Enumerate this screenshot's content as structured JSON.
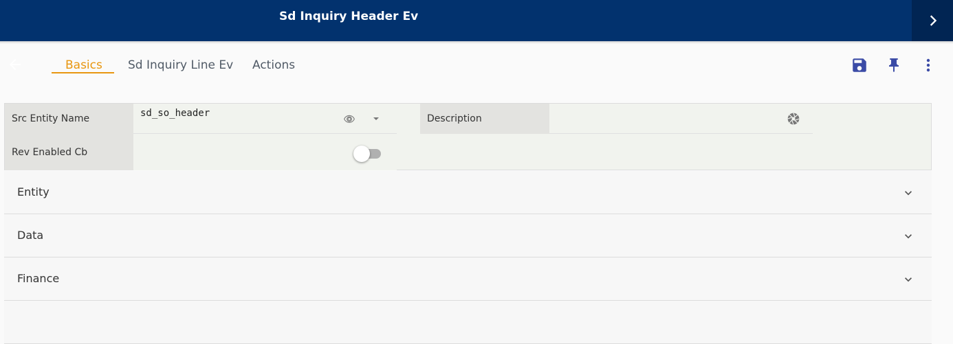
{
  "header": {
    "title": "Sd Inquiry Header Ev",
    "next_icon": "chevron-right-icon"
  },
  "tabs": [
    {
      "label": "Basics",
      "active": true
    },
    {
      "label": "Sd Inquiry Line Ev",
      "active": false
    },
    {
      "label": "Actions",
      "active": false
    }
  ],
  "toolbar": {
    "icons": [
      "save-icon",
      "pin-icon",
      "more-vert-icon"
    ],
    "accent_color": "#3b4ba6"
  },
  "form": {
    "fields": [
      {
        "label": "Src Entity Name",
        "value": "sd_so_header"
      },
      {
        "label": "Description",
        "value": ""
      },
      {
        "label": "Rev Enabled Cb",
        "value": false
      }
    ]
  },
  "sections": [
    {
      "label": "Entity"
    },
    {
      "label": "Data"
    },
    {
      "label": "Finance"
    }
  ],
  "colors": {
    "header_bg": "#02326e",
    "tab_active": "#e8960f",
    "tab_inactive": "#505a66"
  }
}
